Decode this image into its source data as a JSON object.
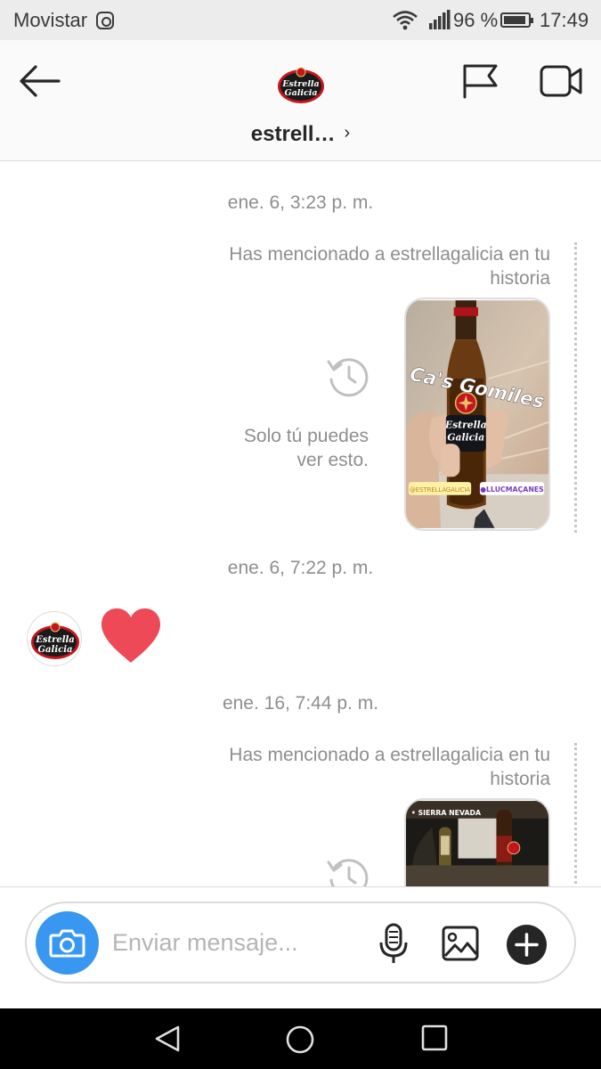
{
  "status_bar": {
    "carrier": "Movistar",
    "battery": "96 %",
    "time": "17:49",
    "icons": [
      "instagram-icon",
      "wifi-icon",
      "signal-icon",
      "battery-icon"
    ]
  },
  "header": {
    "username": "estrell…",
    "chevron": "›",
    "avatar_logo_line1": "Estrella",
    "avatar_logo_line2": "Galicia",
    "icons": [
      "back-arrow-icon",
      "flag-icon",
      "video-call-icon"
    ]
  },
  "thread": {
    "items": [
      {
        "type": "timestamp",
        "text": "ene. 6, 3:23 p. m."
      },
      {
        "type": "story_mention",
        "text": "Has mencionado a estrellagalicia en tu historia",
        "note": "Solo tú puedes ver esto.",
        "note_line1": "Solo tú puedes",
        "note_line2": "ver esto.",
        "story_caption": "Ca's Gomiles",
        "story_label": "Estrella Galicia",
        "story_label_line1": "Estrella",
        "story_label_line2": "Galicia",
        "sticker_left": "@ESTRELLAGALICIA",
        "sticker_right": "●LLUCMAÇANES"
      },
      {
        "type": "timestamp",
        "text": "ene. 6, 7:22 p. m."
      },
      {
        "type": "reaction",
        "emoji": "heart",
        "sender": "estrellagalicia"
      },
      {
        "type": "timestamp",
        "text": "ene. 16, 7:44 p. m."
      },
      {
        "type": "story_mention",
        "text": "Has mencionado a estrellagalicia en tu historia",
        "story_tag": "• SIERRA NEVADA"
      }
    ]
  },
  "composer": {
    "placeholder": "Enviar mensaje...",
    "icons": [
      "camera-icon",
      "microphone-icon",
      "gallery-icon",
      "plus-icon"
    ]
  },
  "nav_bar": {
    "icons": [
      "back-triangle-icon",
      "home-circle-icon",
      "recents-square-icon"
    ]
  },
  "colors": {
    "accent_blue": "#3897f0",
    "heart_red": "#ed4956",
    "secondary_text": "#8e8e8e",
    "brand_red": "#c4161c"
  }
}
